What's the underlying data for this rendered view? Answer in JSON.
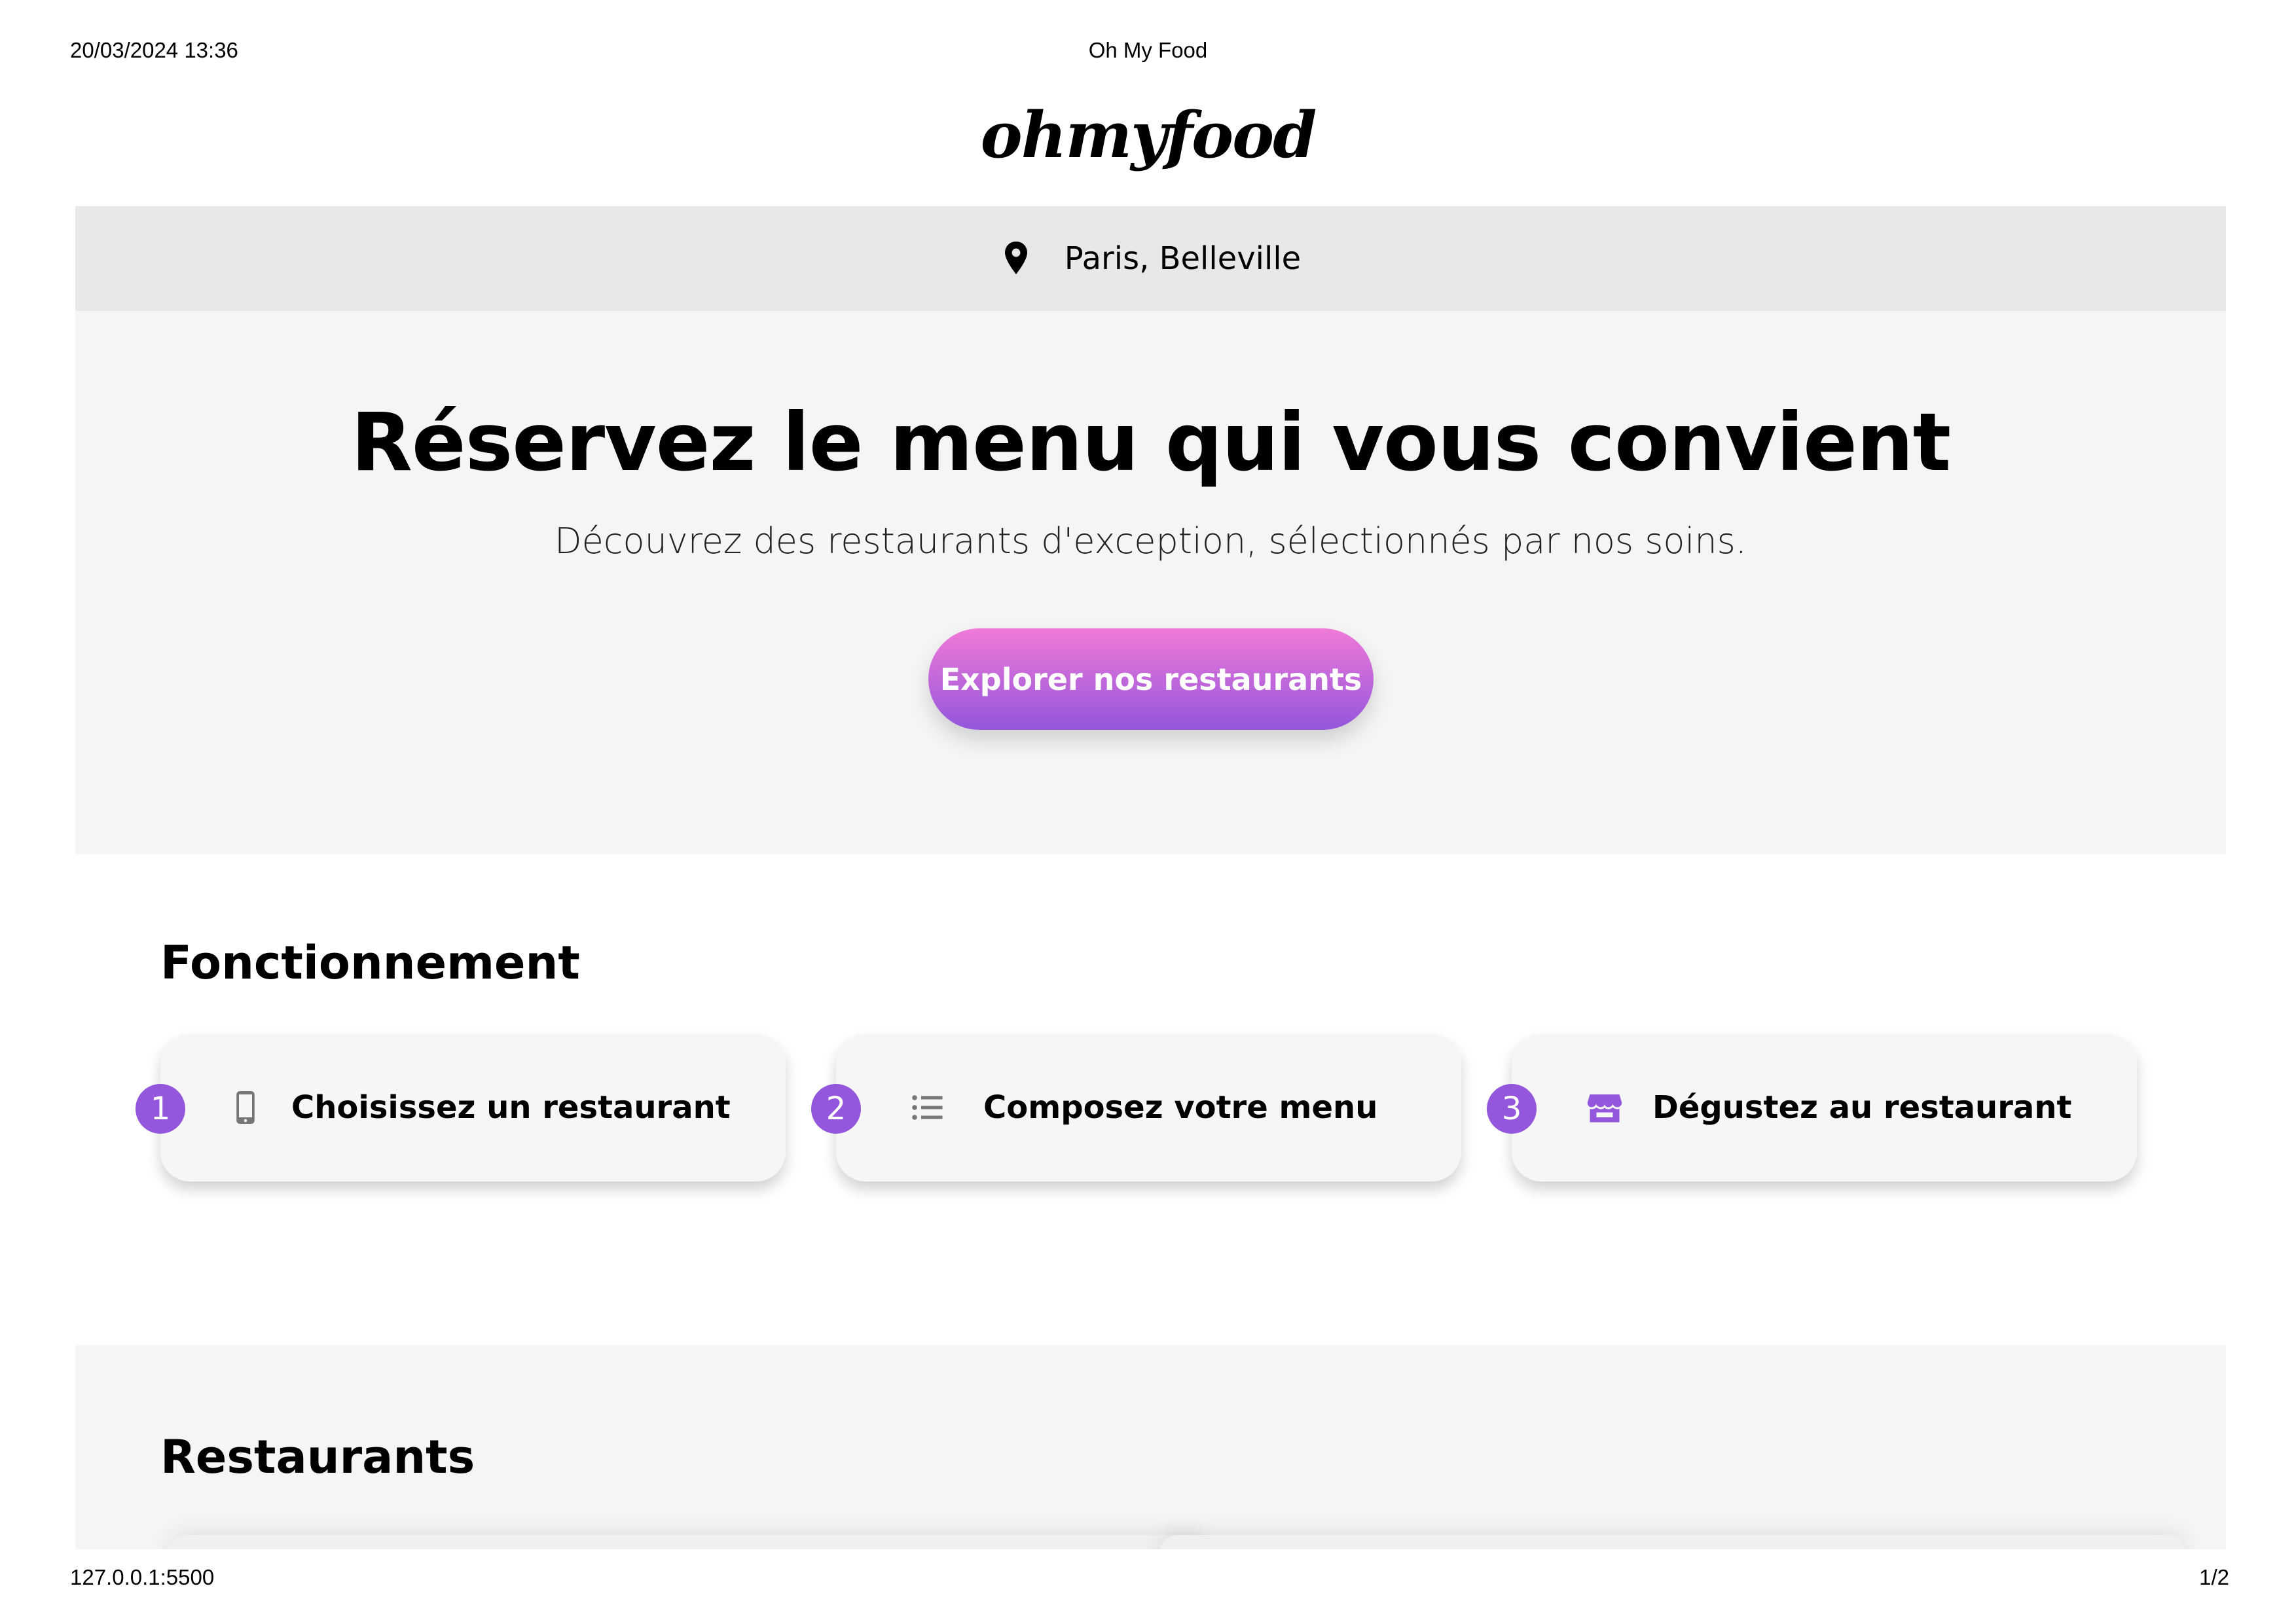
{
  "print": {
    "datetime": "20/03/2024 13:36",
    "doc_title": "Oh My Food",
    "url": "127.0.0.1:5500",
    "page_counter": "1/2"
  },
  "brand": {
    "logo_text": "ohmyfood",
    "accent": "#9356dc",
    "gradient_start": "#f07ad8",
    "gradient_end": "#9356dc"
  },
  "location": {
    "icon": "map-pin-icon",
    "text": "Paris, Belleville"
  },
  "hero": {
    "title": "Réservez le menu qui vous convient",
    "subtitle": "Découvrez des restaurants d'exception, sélectionnés par nos soins.",
    "cta_label": "Explorer nos restaurants"
  },
  "how_it_works": {
    "title": "Fonctionnement",
    "steps": [
      {
        "number": "1",
        "icon": "smartphone-icon",
        "label": "Choisissez un restaurant"
      },
      {
        "number": "2",
        "icon": "list-icon",
        "label": "Composez votre menu"
      },
      {
        "number": "3",
        "icon": "store-icon",
        "label": "Dégustez au restaurant"
      }
    ]
  },
  "restaurants": {
    "title": "Restaurants"
  }
}
